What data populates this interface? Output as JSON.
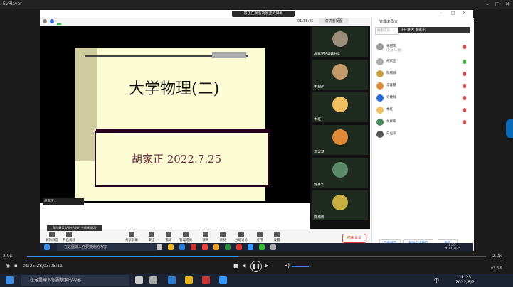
{
  "player": {
    "title": "EVPlayer",
    "speed_left": "2.0x",
    "speed_right": "2.0x",
    "time": "01:25:28/03:05:11",
    "progress": 0.46,
    "version": "v3.3.6"
  },
  "meeting": {
    "share_banner": "您正在观看胡家正的屏幕",
    "timer": "01:38:45",
    "view_label": "演讲者视图",
    "slide_title": "大学物理(二)",
    "slide_subtitle": "胡家正 2022.7.25",
    "presenter_tag": "胡家正...",
    "tooltip": "解除静音 (Alt+A/按住空格键说话)",
    "end_meeting": "结束会议"
  },
  "gallery": {
    "tiles": [
      {
        "name": "胡家正的屏幕共享",
        "color": "#9a8d7a"
      },
      {
        "name": "林甜萍",
        "color": "#c49a68"
      },
      {
        "name": "林虹",
        "color": "#f0c060"
      },
      {
        "name": "马宴慧",
        "color": "#e08a38"
      },
      {
        "name": "余慕华",
        "color": "#5a8a6a"
      },
      {
        "name": "陈楠娜",
        "color": "#c8b040"
      }
    ]
  },
  "panel": {
    "title": "管理成员(8)",
    "search_placeholder": "搜索成员",
    "speaking": "正在讲话: 胡家正;",
    "participants": [
      {
        "name": "林甜萍",
        "sub": "(主持人, 我)",
        "color": "#999",
        "mic": "red"
      },
      {
        "name": "胡家正",
        "sub": "",
        "color": "#aaa",
        "mic": "green"
      },
      {
        "name": "陈楠娜",
        "sub": "",
        "color": "#c8a040",
        "mic": "red"
      },
      {
        "name": "马宴慧",
        "sub": "",
        "color": "#e08a38",
        "mic": "red"
      },
      {
        "name": "许婕群",
        "sub": "",
        "color": "#2a6ad8",
        "mic": "red"
      },
      {
        "name": "林虹",
        "sub": "",
        "color": "#f0c060",
        "mic": "red"
      },
      {
        "name": "余慕华",
        "sub": "",
        "color": "#4a8a5a",
        "mic": "red"
      },
      {
        "name": "朱启凤",
        "sub": "",
        "color": "#555",
        "mic": ""
      }
    ],
    "btn_mute_all": "全体静音",
    "btn_unmute_all": "解除全体静音",
    "btn_more": "更多"
  },
  "toolbar": {
    "items": [
      "解除静音",
      "开启视频",
      "共享屏幕",
      "安全",
      "邀请",
      "管理成员(8)",
      "聊天",
      "录制",
      "分组讨论",
      "应用",
      "设置"
    ]
  },
  "inner_taskbar": {
    "search": "在这里输入你要搜索的内容",
    "time": "9:55",
    "date": "2022/7/25"
  },
  "outer_taskbar": {
    "search": "在这里输入你要搜索的内容",
    "time": "11:25",
    "date": "2022/8/2",
    "lang": "中"
  }
}
